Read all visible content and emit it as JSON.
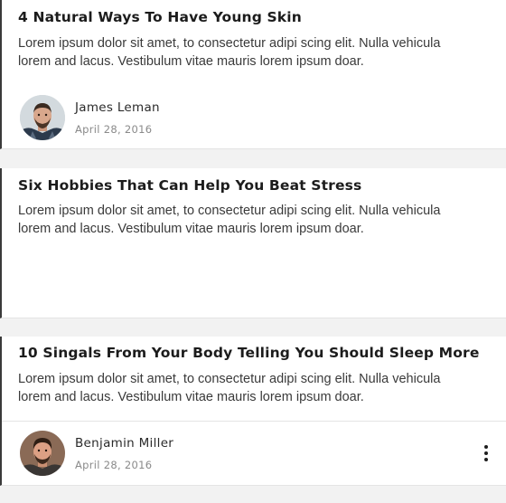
{
  "posts": [
    {
      "title": "4 Natural Ways To Have Young Skin",
      "excerpt_line1": "Lorem ipsum dolor sit amet, to consectetur  adipi scing elit. Nulla vehicula",
      "excerpt_line2": "lorem and lacus. Vestibulum vitae mauris lorem ipsum doar.",
      "author": {
        "name": "James Leman",
        "date": "April 28, 2016"
      }
    },
    {
      "title": "Six Hobbies That Can Help You Beat Stress",
      "excerpt_line1": "Lorem ipsum dolor sit amet, to consectetur  adipi scing elit. Nulla vehicula",
      "excerpt_line2": "lorem and lacus. Vestibulum vitae mauris lorem ipsum doar."
    },
    {
      "title": "10 Singals From Your Body Telling You Should Sleep More",
      "excerpt_line1": "Lorem ipsum dolor sit amet, to consectetur  adipi scing elit. Nulla vehicula",
      "excerpt_line2": "lorem and lacus. Vestibulum vitae mauris lorem ipsum doar.",
      "author": {
        "name": "Benjamin Miller",
        "date": "April 28, 2016"
      },
      "more_icon": "more-vertical-icon"
    }
  ],
  "colors": {
    "page_background": "#f2f2f2",
    "card_background": "#ffffff",
    "title_text": "#1c1c1c",
    "body_text": "#3a3a3a",
    "date_text": "#8a8a8a",
    "card_left_accent": "#3a3a3a"
  }
}
